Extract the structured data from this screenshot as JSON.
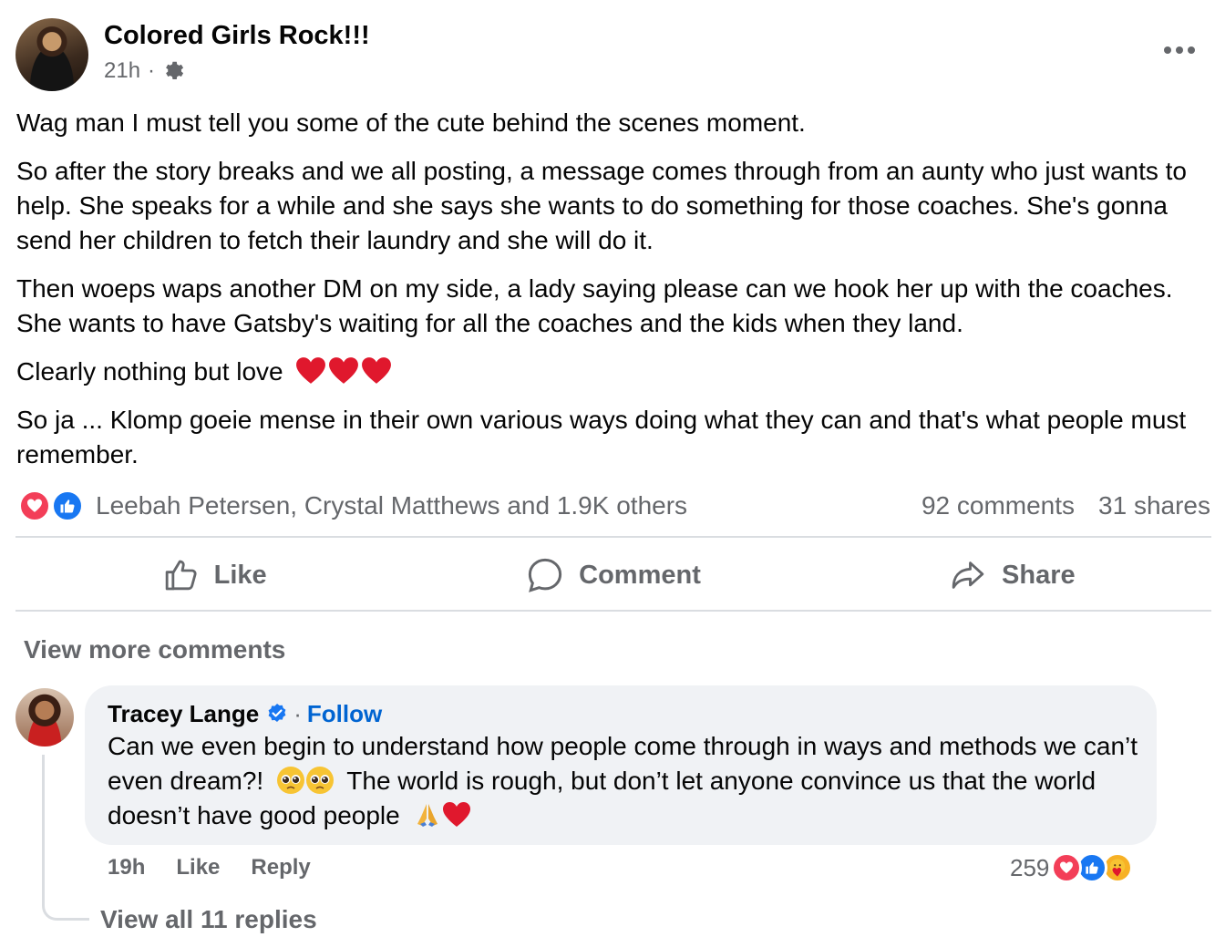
{
  "post": {
    "page_name": "Colored Girls Rock!!!",
    "time": "21h",
    "separator": "·",
    "privacy_icon": "gear-icon",
    "more_icon": "ellipsis-icon",
    "paragraphs": [
      "Wag man I must tell you some of the cute behind the scenes moment.",
      "So after the story breaks and we all posting, a message comes through from an aunty who just wants to help. She speaks for a while and she says she wants to do something for those coaches. She's gonna send her children to fetch their laundry and she will do it.",
      "Then woeps waps another DM on my side, a lady saying please can we hook her up with the coaches. She wants to have Gatsby's waiting for all the coaches and the kids when they land.",
      "Clearly nothing but love",
      "So ja ... Klomp goeie mense in their own various ways doing what they can and that's what people must remember."
    ],
    "hearts_emoji": "heart-emoji"
  },
  "reactions": {
    "icons": [
      "love-reaction-icon",
      "like-reaction-icon"
    ],
    "names": "Leebah Petersen, Crystal Matthews and 1.9K others",
    "comments": "92 comments",
    "shares": "31 shares"
  },
  "actions": {
    "like": "Like",
    "comment": "Comment",
    "share": "Share"
  },
  "comments_section": {
    "view_more": "View more comments",
    "comment": {
      "author": "Tracey Lange",
      "verified_icon": "verified-badge-icon",
      "separator": "·",
      "follow": "Follow",
      "text_1": "Can we even begin to understand how people come through in ways and methods we can’t even dream?!",
      "text_2": "The world is rough, but don’t let anyone convince us that the world doesn’t have good people",
      "time": "19h",
      "like": "Like",
      "reply": "Reply",
      "reaction_count": "259",
      "reaction_icons": [
        "love-reaction-icon",
        "like-reaction-icon",
        "care-reaction-icon"
      ]
    },
    "view_replies": "View all 11 replies"
  },
  "colors": {
    "text": "#050505",
    "secondary": "#65676b",
    "link_blue": "#0064d1",
    "bubble": "#f0f2f5",
    "love": "#f33e58",
    "like": "#1877f2"
  }
}
